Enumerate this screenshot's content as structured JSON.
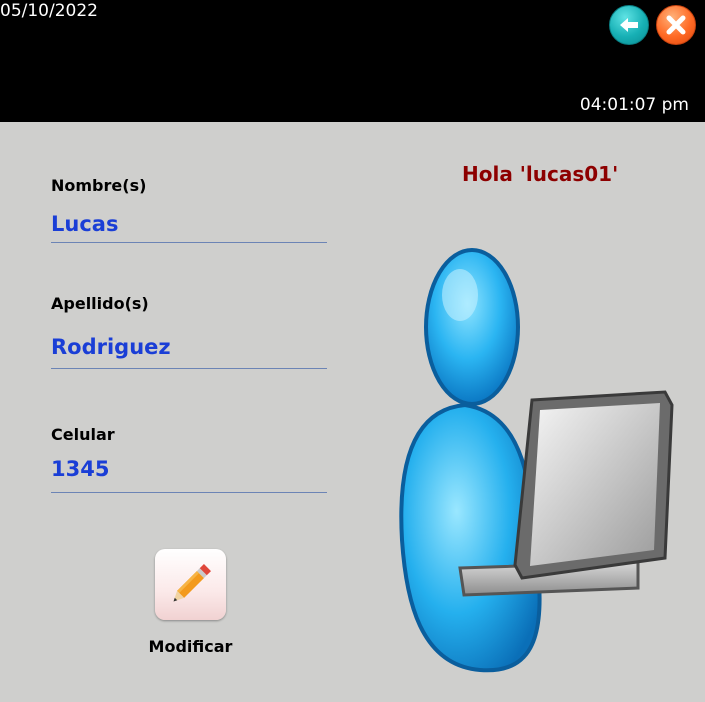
{
  "header": {
    "date": "05/10/2022",
    "time": "04:01:07 pm",
    "back_icon": "arrow-left-icon",
    "close_icon": "close-x-icon"
  },
  "greeting": "Hola 'lucas01'",
  "form": {
    "fields": [
      {
        "label": "Nombre(s)",
        "value": "Lucas"
      },
      {
        "label": "Apellido(s)",
        "value": "Rodriguez"
      },
      {
        "label": "Celular",
        "value": "1345"
      }
    ]
  },
  "modify": {
    "label": "Modificar",
    "icon": "pencil-icon"
  },
  "illustration": "user-with-computer-icon",
  "colors": {
    "background": "#cfcfcd",
    "topbar": "#000000",
    "value_text": "#1a3ed6",
    "greeting_text": "#8d0000",
    "underline": "#6c84b5",
    "back_button": "#17b0b5",
    "close_button": "#ff6a25"
  }
}
